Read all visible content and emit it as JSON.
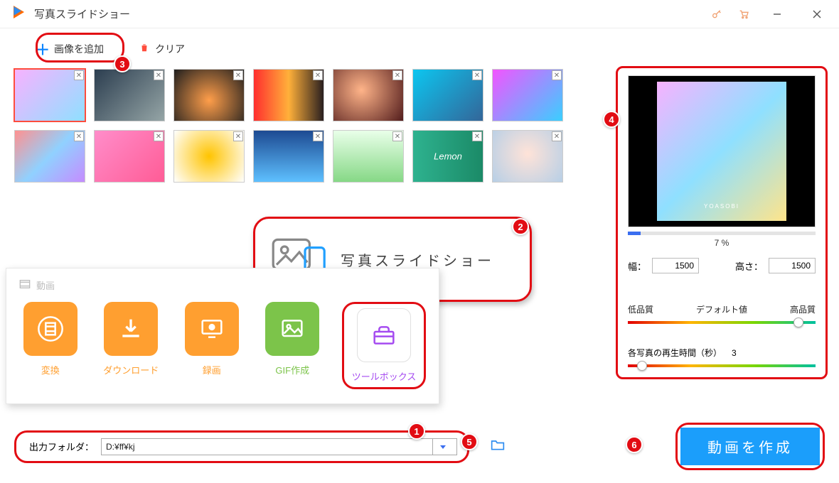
{
  "app": {
    "title": "写真スライドショー"
  },
  "toolbar": {
    "add_label": "画像を追加",
    "clear_label": "クリア"
  },
  "thumbs": [
    "t0",
    "t1",
    "t2",
    "t3",
    "t4",
    "t5",
    "t6",
    "t7",
    "t8",
    "t9",
    "t10",
    "t11",
    "t12",
    "t13"
  ],
  "feature": {
    "label": "写真スライドショー"
  },
  "tools": {
    "header": "動画",
    "convert": "変換",
    "download": "ダウンロード",
    "record": "録画",
    "gif": "GIF作成",
    "toolbox": "ツールボックス"
  },
  "preview": {
    "progress_text": "7 %",
    "progress_pct": 7,
    "width_label": "幅：",
    "width_value": "1500",
    "height_label": "高さ：",
    "height_value": "1500",
    "quality_low": "低品質",
    "quality_default": "デフォルト値",
    "quality_high": "高品質",
    "duration_label": "各写真の再生時間（秒）",
    "duration_value": "3"
  },
  "output": {
    "label": "出力フォルダ：",
    "value": "D:¥ff¥kj"
  },
  "create": {
    "label": "動画を作成"
  },
  "badges": {
    "b1": "1",
    "b2": "2",
    "b3": "3",
    "b4": "4",
    "b5": "5",
    "b6": "6"
  }
}
